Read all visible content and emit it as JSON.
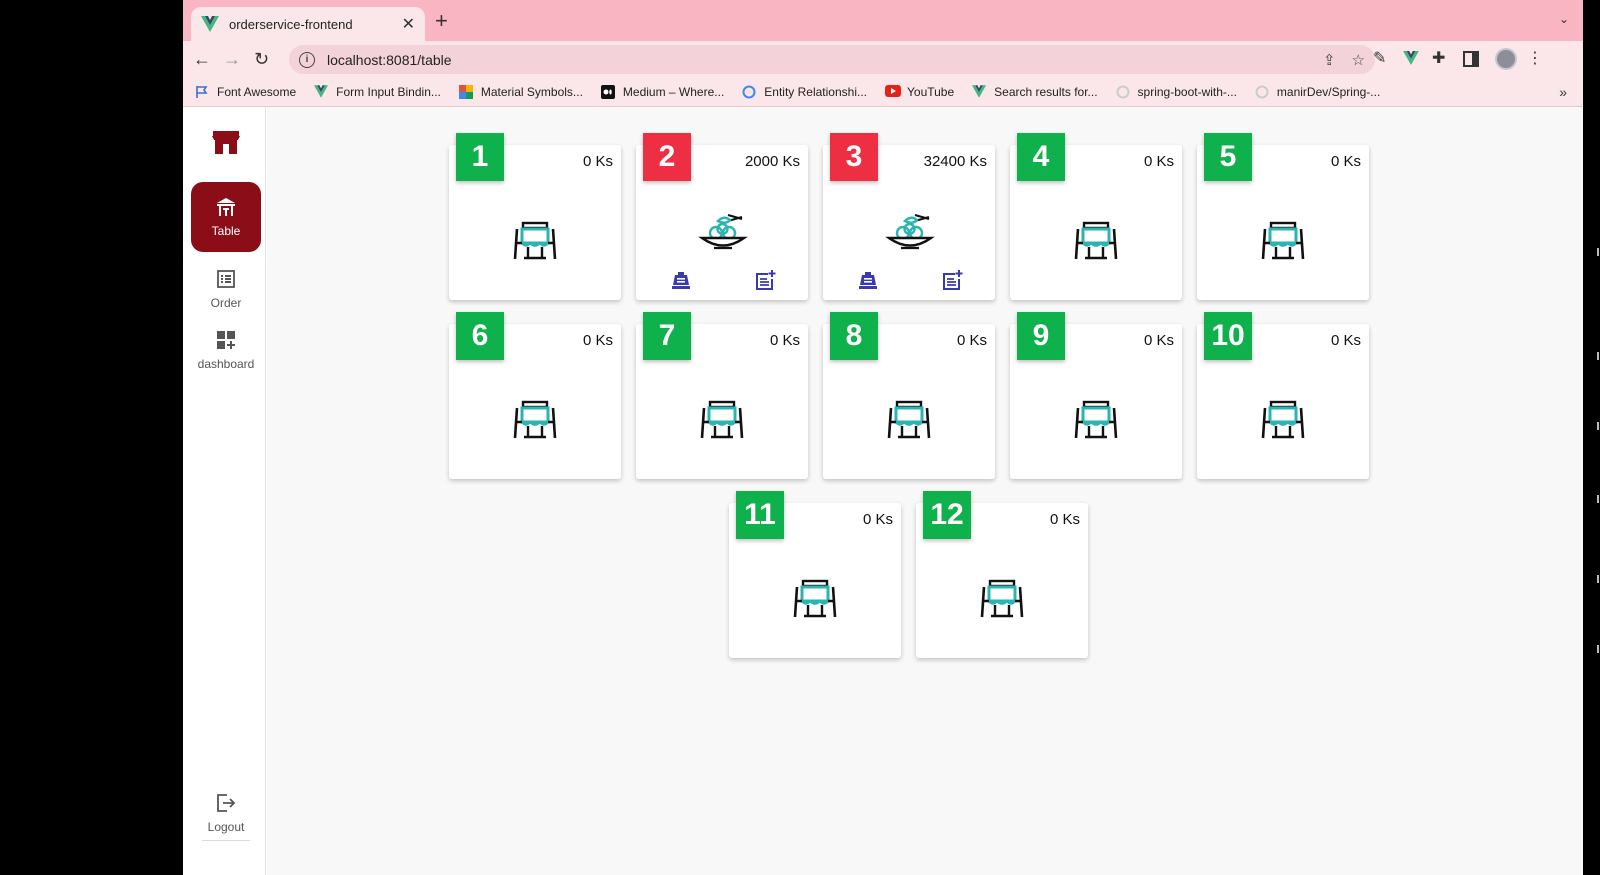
{
  "browser": {
    "tab_title": "orderservice-frontend",
    "tab_close": "✕",
    "new_tab": "+",
    "tab_menu": "⌄",
    "url": "localhost:8081/table",
    "bookmarks": [
      {
        "label": "Font Awesome",
        "icon": "flag-icon",
        "color": "#3b6fd8"
      },
      {
        "label": "Form Input Bindin...",
        "icon": "vue-icon",
        "color": "#3ca47a"
      },
      {
        "label": "Material Symbols...",
        "icon": "material-icon",
        "color": "#e0533d"
      },
      {
        "label": "Medium – Where...",
        "icon": "medium-icon",
        "color": "#111111"
      },
      {
        "label": "Entity Relationshi...",
        "icon": "ring-icon",
        "color": "#4285f4"
      },
      {
        "label": "YouTube",
        "icon": "youtube-icon",
        "color": "#e62117"
      },
      {
        "label": "Search results for...",
        "icon": "vue-icon",
        "color": "#3ca47a"
      },
      {
        "label": "spring-boot-with-...",
        "icon": "github-icon",
        "color": "#cccccc"
      },
      {
        "label": "manirDev/Spring-...",
        "icon": "github-icon",
        "color": "#cccccc"
      }
    ],
    "bookmarks_more": "»"
  },
  "sidebar": {
    "items": [
      {
        "label": "Table",
        "icon": "table-restaurant-icon",
        "active": true
      },
      {
        "label": "Order",
        "icon": "list-icon",
        "active": false
      },
      {
        "label": "dashboard",
        "icon": "dashboard-icon",
        "active": false
      }
    ],
    "logout": "Logout"
  },
  "colors": {
    "free": "#0fb14c",
    "busy": "#ee2f43",
    "accent": "#8b0d18",
    "table_cloth": "#2bb5b2",
    "action_icons": "#3a3ab0"
  },
  "tables": [
    {
      "number": "1",
      "amount": "0 Ks",
      "status": "free"
    },
    {
      "number": "2",
      "amount": "2000 Ks",
      "status": "busy"
    },
    {
      "number": "3",
      "amount": "32400 Ks",
      "status": "busy"
    },
    {
      "number": "4",
      "amount": "0 Ks",
      "status": "free"
    },
    {
      "number": "5",
      "amount": "0 Ks",
      "status": "free"
    },
    {
      "number": "6",
      "amount": "0 Ks",
      "status": "free"
    },
    {
      "number": "7",
      "amount": "0 Ks",
      "status": "free"
    },
    {
      "number": "8",
      "amount": "0 Ks",
      "status": "free"
    },
    {
      "number": "9",
      "amount": "0 Ks",
      "status": "free"
    },
    {
      "number": "10",
      "amount": "0 Ks",
      "status": "free"
    },
    {
      "number": "11",
      "amount": "0 Ks",
      "status": "free"
    },
    {
      "number": "12",
      "amount": "0 Ks",
      "status": "free"
    }
  ]
}
